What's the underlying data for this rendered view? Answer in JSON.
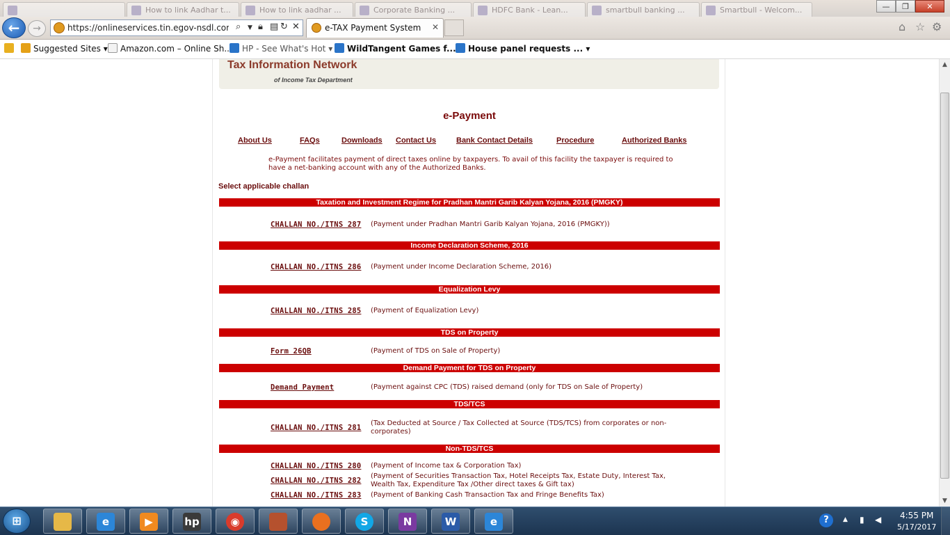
{
  "browser": {
    "url": "https://onlineservices.tin.egov-nsdl.com/eta",
    "active_tab_title": "e-TAX Payment System",
    "active_tab_close": "✕",
    "background_tabs": [
      "",
      "How to link Aadhar t...",
      "How to link aadhar ...",
      "Corporate Banking ...",
      "HDFC Bank - Lean...",
      "smartbull banking ...",
      "Smartbull - Welcom..."
    ],
    "window_buttons": {
      "minimize": "—",
      "maximize": "❐",
      "close": "✕"
    },
    "favorites": [
      {
        "label": "Suggested Sites ▾",
        "icon": "bing-icon"
      },
      {
        "label": "Amazon.com – Online Sh...",
        "icon": "amazon-icon"
      },
      {
        "label": "HP - See What's Hot ▾",
        "icon": "ie-page-icon"
      },
      {
        "label": "WildTangent Games f... ▾",
        "icon": "ie-page-icon"
      },
      {
        "label": "House panel requests ... ▾",
        "icon": "ie-page-icon"
      }
    ]
  },
  "header": {
    "title": "Tax Information Network",
    "subtitle": "of Income Tax Department"
  },
  "page": {
    "heading": "e-Payment",
    "nav_links": [
      "About Us",
      "FAQs",
      "Downloads",
      "Contact Us",
      "Bank Contact Details",
      "Procedure",
      "Authorized Banks"
    ],
    "intro": "e-Payment facilitates payment of direct taxes online by taxpayers. To avail of this facility the taxpayer is required to have a net-banking account with any of the Authorized Banks.",
    "select_label": "Select applicable challan",
    "sections": [
      {
        "title": "Taxation and Investment Regime for Pradhan Mantri Garib Kalyan Yojana, 2016 (PMGKY)",
        "items": [
          {
            "link": "CHALLAN NO./ITNS 287",
            "desc": "(Payment under Pradhan Mantri Garib Kalyan Yojana, 2016 (PMGKY))"
          }
        ]
      },
      {
        "title": "Income Declaration Scheme, 2016",
        "items": [
          {
            "link": "CHALLAN NO./ITNS 286",
            "desc": "(Payment under Income Declaration Scheme, 2016)"
          }
        ]
      },
      {
        "title": "Equalization Levy",
        "items": [
          {
            "link": "CHALLAN NO./ITNS 285",
            "desc": "(Payment of Equalization Levy)"
          }
        ]
      },
      {
        "title": "TDS on Property",
        "items": [
          {
            "link": "Form 26QB",
            "desc": "(Payment of TDS on Sale of Property)"
          }
        ]
      },
      {
        "title": "Demand Payment for TDS on Property",
        "items": [
          {
            "link": "Demand Payment",
            "desc": "(Payment against CPC (TDS) raised demand (only for TDS on Sale of Property)"
          }
        ]
      },
      {
        "title": "TDS/TCS",
        "items": [
          {
            "link": "CHALLAN NO./ITNS 281",
            "desc": "(Tax Deducted at Source / Tax Collected at Source (TDS/TCS) from corporates or non-corporates)"
          }
        ]
      },
      {
        "title": "Non-TDS/TCS",
        "items": [
          {
            "link": "CHALLAN NO./ITNS 280",
            "desc": "(Payment of Income tax & Corporation Tax)"
          },
          {
            "link": "CHALLAN NO./ITNS 282",
            "desc": "(Payment of Securities Transaction Tax, Hotel Receipts Tax, Estate Duty, Interest Tax, Wealth Tax, Expenditure Tax /Other direct taxes & Gift tax)"
          },
          {
            "link": "CHALLAN NO./ITNS 283",
            "desc": "(Payment of Banking Cash Transaction Tax and Fringe Benefits Tax)"
          }
        ]
      }
    ]
  },
  "colors": {
    "section_bar": "#cc0000",
    "link": "#6a0d0d",
    "heading": "#7a0a0a",
    "header_bg": "#f0efe7"
  },
  "taskbar": {
    "apps": [
      "file-explorer-icon",
      "ie-icon",
      "media-player-icon",
      "hp-icon",
      "chrome-icon",
      "presentation-icon",
      "firefox-icon",
      "skype-icon",
      "onenote-icon",
      "word-icon",
      "ie-icon"
    ],
    "time": "4:55 PM",
    "date": "5/17/2017",
    "help": "?"
  }
}
